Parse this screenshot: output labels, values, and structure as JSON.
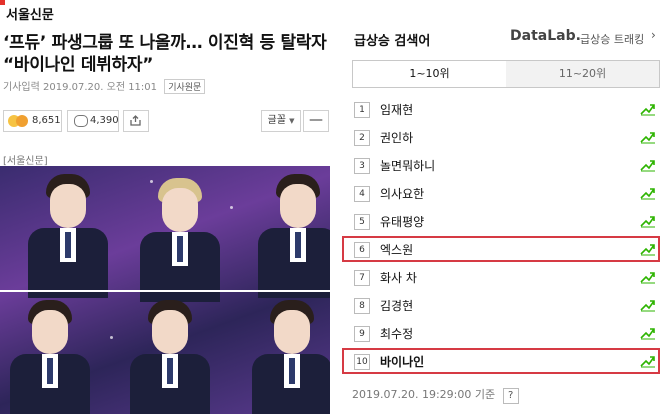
{
  "article": {
    "publisher": "서울신문",
    "headline_line1": "‘프듀’ 파생그룹 또 나올까… 이진혁 등 탈락자",
    "headline_line2": "“바이나인 데뷔하자”",
    "meta_prefix": "기사입력",
    "meta_time": "2019.07.20. 오전 11:01",
    "original_label": "기사원문",
    "reaction_count": "8,651",
    "comment_count": "4,390",
    "font_label": "글꼴",
    "minus_label": "—",
    "photo_caption": "[서울신문]"
  },
  "realtime": {
    "title": "급상승 검색어",
    "datalab": "DataLab.",
    "datalab_sub": "급상승 트래킹",
    "arrow": "›",
    "tabs": [
      "1~10위",
      "11~20위"
    ],
    "items": [
      {
        "rank": "1",
        "label": "임재현"
      },
      {
        "rank": "2",
        "label": "권인하"
      },
      {
        "rank": "3",
        "label": "놀면뭐하니"
      },
      {
        "rank": "4",
        "label": "의사요한"
      },
      {
        "rank": "5",
        "label": "유태평양"
      },
      {
        "rank": "6",
        "label": "엑스원"
      },
      {
        "rank": "7",
        "label": "화사 차"
      },
      {
        "rank": "8",
        "label": "김경현"
      },
      {
        "rank": "9",
        "label": "최수정"
      },
      {
        "rank": "10",
        "label": "바이나인"
      }
    ],
    "timestamp": "2019.07.20. 19:29:00 기준",
    "help": "?",
    "highlight_color": "#d63a44",
    "trend_color": "#2db400"
  }
}
